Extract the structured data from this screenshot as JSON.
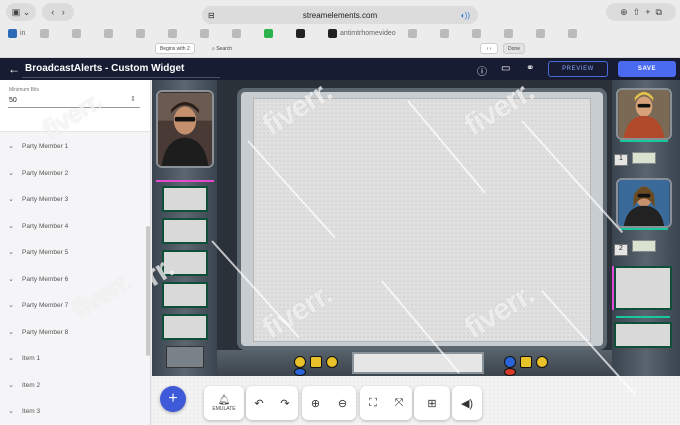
{
  "browser": {
    "url": "streamelements.com",
    "find": {
      "mode": "Begins with",
      "count": "2",
      "placeholder": "Search",
      "done": "Done"
    },
    "bookmarks": [
      "in",
      "",
      "",
      "",
      "",
      "",
      "",
      "",
      "",
      "",
      "",
      "",
      "",
      "antimtrhomevideo",
      "",
      "",
      "",
      "",
      "",
      "",
      "",
      "",
      ""
    ]
  },
  "app": {
    "title": "BroadcastAlerts - Custom Widget",
    "preview": "PREVIEW",
    "save": "SAVE"
  },
  "sidebar": {
    "minimum_bits_label": "Minimum Bits",
    "minimum_bits_value": "50",
    "items": [
      "Party Member 1",
      "Party Member 2",
      "Party Member 3",
      "Party Member 4",
      "Party Member 5",
      "Party Member 6",
      "Party Member 7",
      "Party Member 8",
      "Item 1",
      "Item 2",
      "Item 3"
    ]
  },
  "stage": {
    "badge_1": "1",
    "badge_2": "2"
  },
  "toolbar": {
    "emulate": "EMULATE"
  },
  "watermark": "fiverr."
}
